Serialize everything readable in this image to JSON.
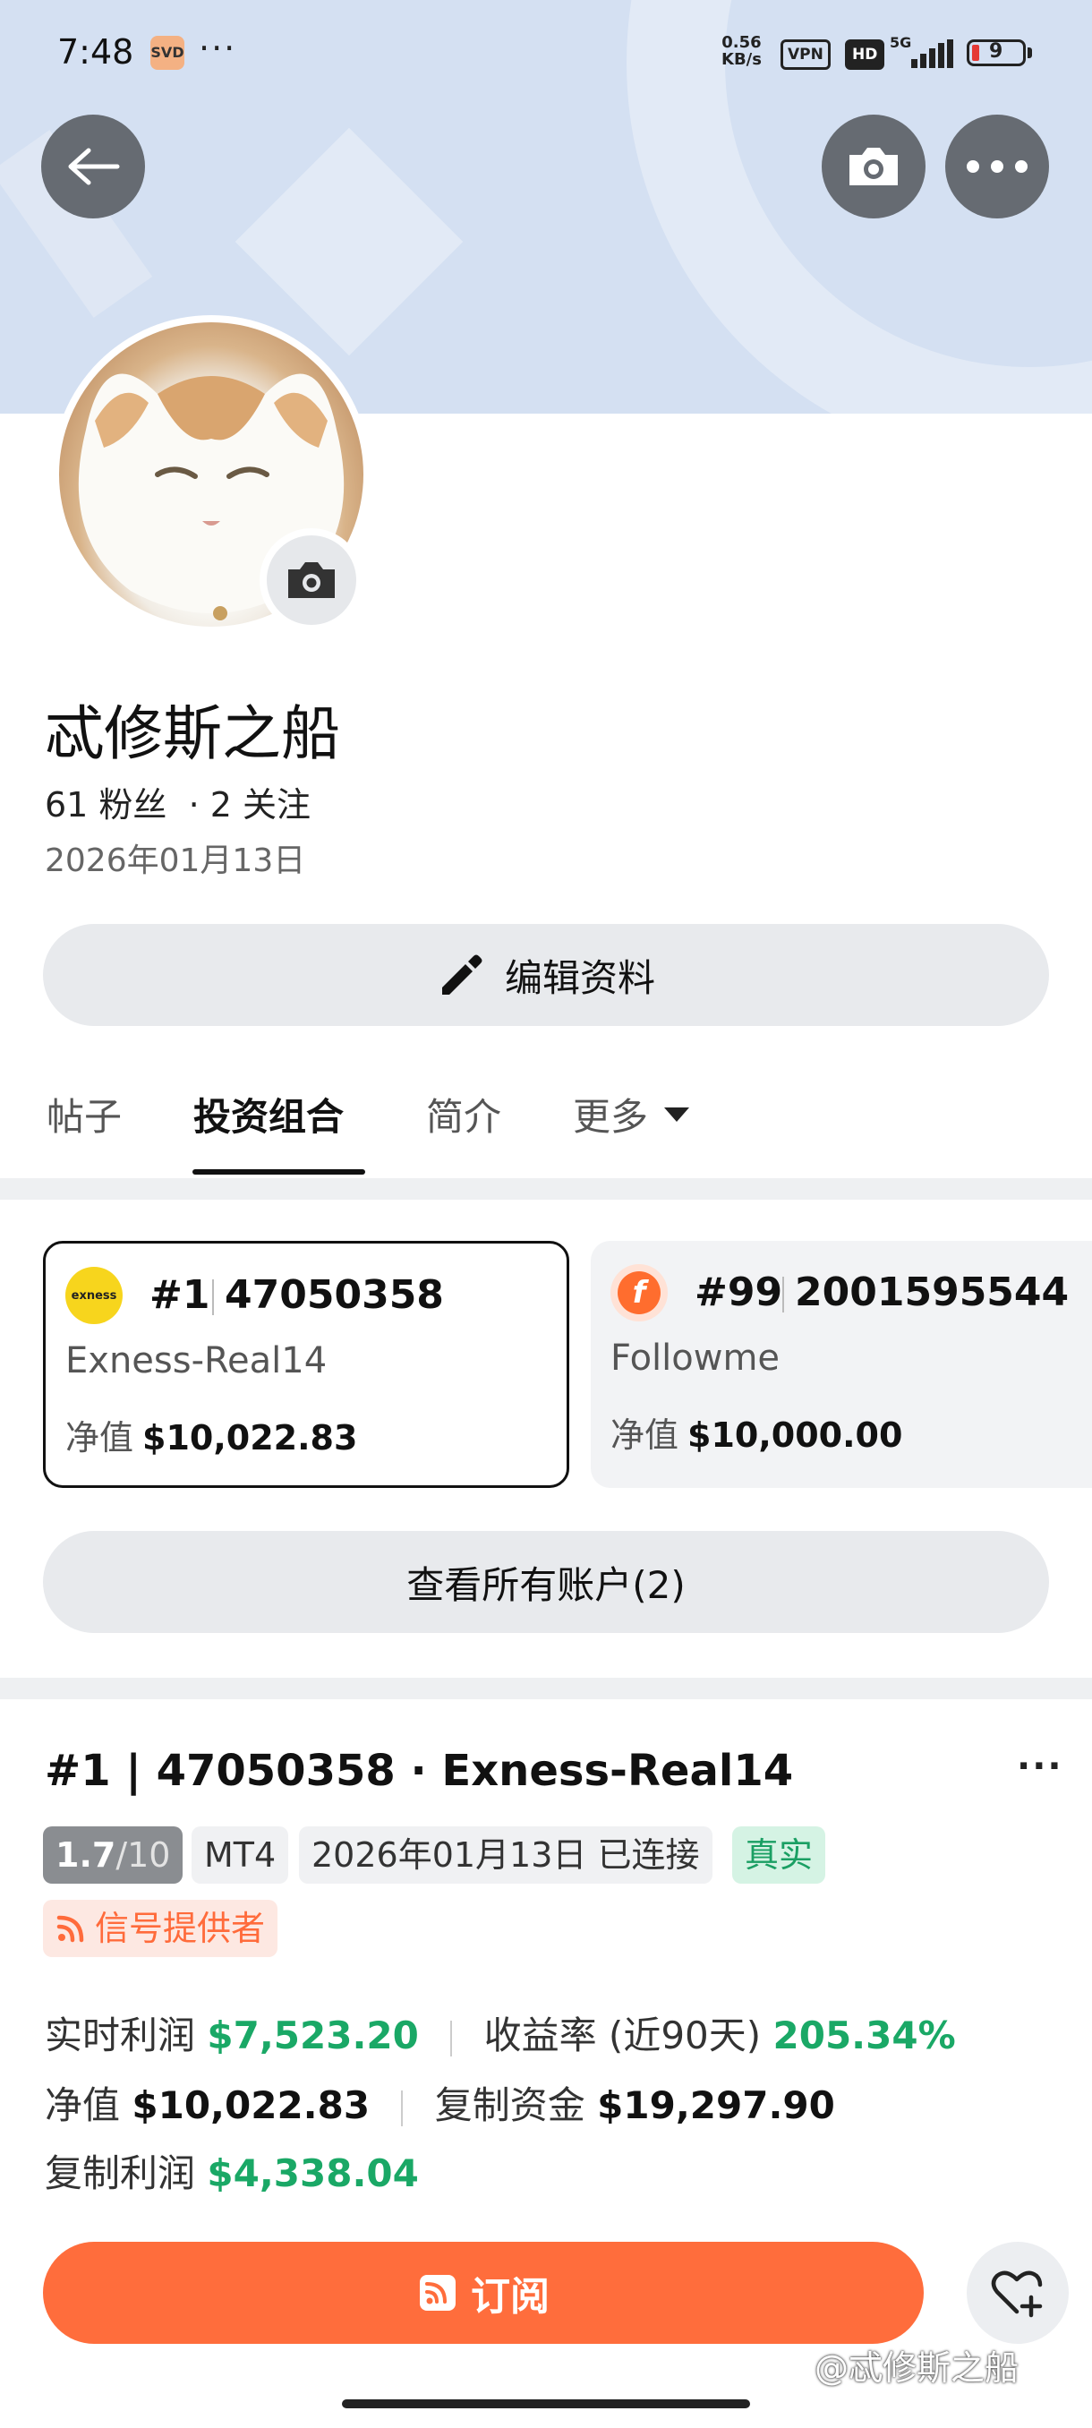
{
  "status_bar": {
    "time": "7:48",
    "app_icon_text": "SVD",
    "more": "···",
    "net_speed_value": "0.56",
    "net_speed_unit": "KB/s",
    "vpn": "VPN",
    "hd": "HD",
    "network": "5G",
    "battery": "9"
  },
  "header": {
    "back_icon": "arrow-left-icon",
    "camera_icon": "camera-icon",
    "more_icon": "more-horizontal-icon"
  },
  "profile": {
    "name": "忒修斯之船",
    "stats": "61 粉丝  · 2 关注",
    "date": "2026年01月13日",
    "edit_label": "编辑资料"
  },
  "tabs": [
    {
      "label": "帖子"
    },
    {
      "label": "投资组合"
    },
    {
      "label": "简介"
    },
    {
      "label": "更多"
    }
  ],
  "active_tab": "投资组合",
  "accounts": [
    {
      "rank": "#1",
      "number": "47050358",
      "server": "Exness-Real14",
      "net_label": "净值",
      "net_value": "$10,022.83",
      "logo_text": "exness",
      "logo_color": "#f7d51d"
    },
    {
      "rank": "#99",
      "number": "2001595544",
      "server": "Followme",
      "net_label": "净值",
      "net_value": "$10,000.00",
      "logo_text": "f",
      "logo_color": "#ff6d2e"
    }
  ],
  "view_all_label": "查看所有账户(2)",
  "detail": {
    "title": "#1 | 47050358 · Exness-Real14",
    "rating_main": "1.7",
    "rating_sub": "/10",
    "platform": "MT4",
    "connected": "2026年01月13日 已连接",
    "real_tag": "真实",
    "signal_tag": "信号提供者",
    "realtime_profit_label": "实时利润",
    "realtime_profit_value": "$7,523.20",
    "return_label": "收益率 (近90天)",
    "return_value": "205.34%",
    "net_label": "净值",
    "net_value": "$10,022.83",
    "copy_funds_label": "复制资金",
    "copy_funds_value": "$19,297.90",
    "copy_profit_label": "复制利润",
    "copy_profit_value": "$4,338.04"
  },
  "subscribe_label": "订阅",
  "watermark": "@忒修斯之船",
  "colors": {
    "accent_orange": "#ff6d3c",
    "profit_green": "#1aa866",
    "banner": "#d4e0f2"
  }
}
